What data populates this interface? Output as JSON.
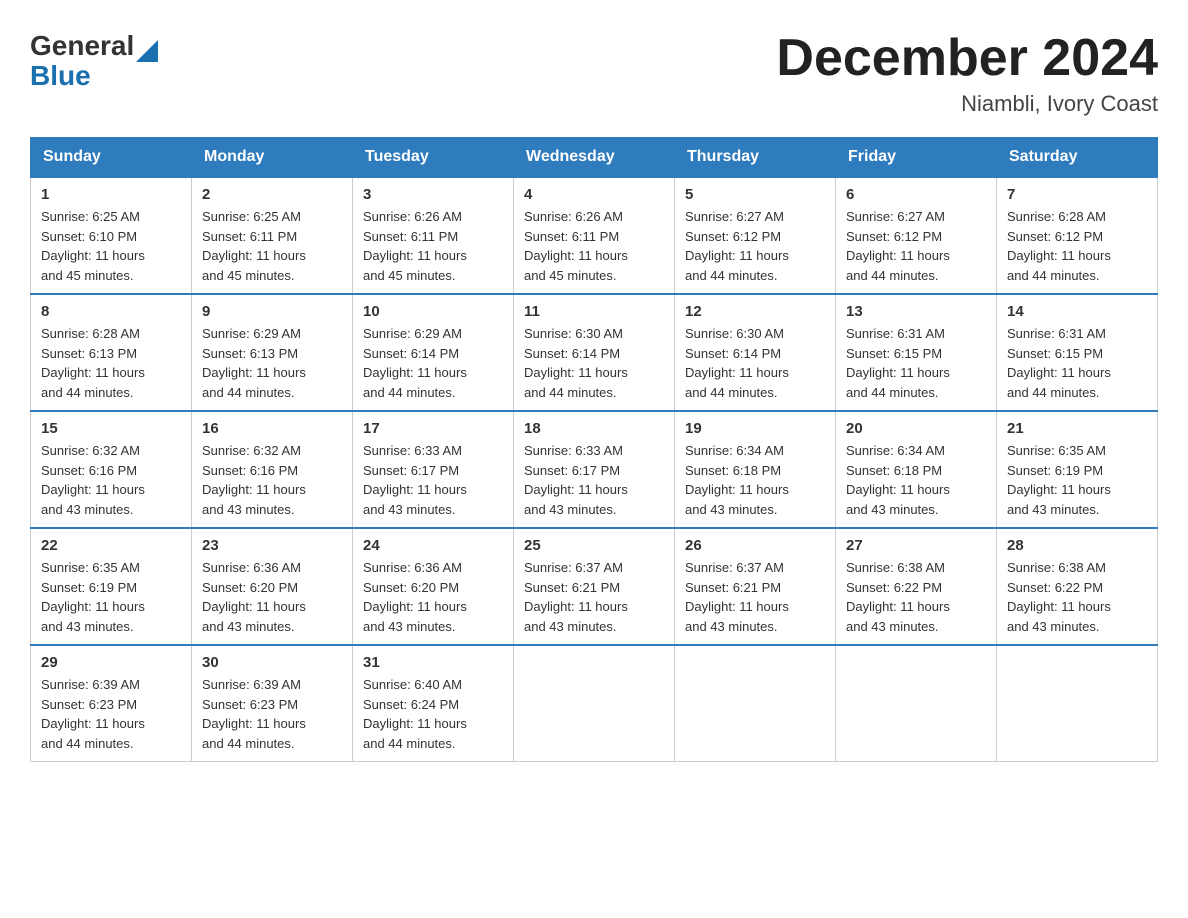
{
  "header": {
    "logo_general": "General",
    "logo_blue": "Blue",
    "month_title": "December 2024",
    "location": "Niambli, Ivory Coast"
  },
  "days_of_week": [
    "Sunday",
    "Monday",
    "Tuesday",
    "Wednesday",
    "Thursday",
    "Friday",
    "Saturday"
  ],
  "weeks": [
    [
      {
        "day": "1",
        "sunrise": "6:25 AM",
        "sunset": "6:10 PM",
        "daylight": "11 hours and 45 minutes."
      },
      {
        "day": "2",
        "sunrise": "6:25 AM",
        "sunset": "6:11 PM",
        "daylight": "11 hours and 45 minutes."
      },
      {
        "day": "3",
        "sunrise": "6:26 AM",
        "sunset": "6:11 PM",
        "daylight": "11 hours and 45 minutes."
      },
      {
        "day": "4",
        "sunrise": "6:26 AM",
        "sunset": "6:11 PM",
        "daylight": "11 hours and 45 minutes."
      },
      {
        "day": "5",
        "sunrise": "6:27 AM",
        "sunset": "6:12 PM",
        "daylight": "11 hours and 44 minutes."
      },
      {
        "day": "6",
        "sunrise": "6:27 AM",
        "sunset": "6:12 PM",
        "daylight": "11 hours and 44 minutes."
      },
      {
        "day": "7",
        "sunrise": "6:28 AM",
        "sunset": "6:12 PM",
        "daylight": "11 hours and 44 minutes."
      }
    ],
    [
      {
        "day": "8",
        "sunrise": "6:28 AM",
        "sunset": "6:13 PM",
        "daylight": "11 hours and 44 minutes."
      },
      {
        "day": "9",
        "sunrise": "6:29 AM",
        "sunset": "6:13 PM",
        "daylight": "11 hours and 44 minutes."
      },
      {
        "day": "10",
        "sunrise": "6:29 AM",
        "sunset": "6:14 PM",
        "daylight": "11 hours and 44 minutes."
      },
      {
        "day": "11",
        "sunrise": "6:30 AM",
        "sunset": "6:14 PM",
        "daylight": "11 hours and 44 minutes."
      },
      {
        "day": "12",
        "sunrise": "6:30 AM",
        "sunset": "6:14 PM",
        "daylight": "11 hours and 44 minutes."
      },
      {
        "day": "13",
        "sunrise": "6:31 AM",
        "sunset": "6:15 PM",
        "daylight": "11 hours and 44 minutes."
      },
      {
        "day": "14",
        "sunrise": "6:31 AM",
        "sunset": "6:15 PM",
        "daylight": "11 hours and 44 minutes."
      }
    ],
    [
      {
        "day": "15",
        "sunrise": "6:32 AM",
        "sunset": "6:16 PM",
        "daylight": "11 hours and 43 minutes."
      },
      {
        "day": "16",
        "sunrise": "6:32 AM",
        "sunset": "6:16 PM",
        "daylight": "11 hours and 43 minutes."
      },
      {
        "day": "17",
        "sunrise": "6:33 AM",
        "sunset": "6:17 PM",
        "daylight": "11 hours and 43 minutes."
      },
      {
        "day": "18",
        "sunrise": "6:33 AM",
        "sunset": "6:17 PM",
        "daylight": "11 hours and 43 minutes."
      },
      {
        "day": "19",
        "sunrise": "6:34 AM",
        "sunset": "6:18 PM",
        "daylight": "11 hours and 43 minutes."
      },
      {
        "day": "20",
        "sunrise": "6:34 AM",
        "sunset": "6:18 PM",
        "daylight": "11 hours and 43 minutes."
      },
      {
        "day": "21",
        "sunrise": "6:35 AM",
        "sunset": "6:19 PM",
        "daylight": "11 hours and 43 minutes."
      }
    ],
    [
      {
        "day": "22",
        "sunrise": "6:35 AM",
        "sunset": "6:19 PM",
        "daylight": "11 hours and 43 minutes."
      },
      {
        "day": "23",
        "sunrise": "6:36 AM",
        "sunset": "6:20 PM",
        "daylight": "11 hours and 43 minutes."
      },
      {
        "day": "24",
        "sunrise": "6:36 AM",
        "sunset": "6:20 PM",
        "daylight": "11 hours and 43 minutes."
      },
      {
        "day": "25",
        "sunrise": "6:37 AM",
        "sunset": "6:21 PM",
        "daylight": "11 hours and 43 minutes."
      },
      {
        "day": "26",
        "sunrise": "6:37 AM",
        "sunset": "6:21 PM",
        "daylight": "11 hours and 43 minutes."
      },
      {
        "day": "27",
        "sunrise": "6:38 AM",
        "sunset": "6:22 PM",
        "daylight": "11 hours and 43 minutes."
      },
      {
        "day": "28",
        "sunrise": "6:38 AM",
        "sunset": "6:22 PM",
        "daylight": "11 hours and 43 minutes."
      }
    ],
    [
      {
        "day": "29",
        "sunrise": "6:39 AM",
        "sunset": "6:23 PM",
        "daylight": "11 hours and 44 minutes."
      },
      {
        "day": "30",
        "sunrise": "6:39 AM",
        "sunset": "6:23 PM",
        "daylight": "11 hours and 44 minutes."
      },
      {
        "day": "31",
        "sunrise": "6:40 AM",
        "sunset": "6:24 PM",
        "daylight": "11 hours and 44 minutes."
      },
      null,
      null,
      null,
      null
    ]
  ],
  "labels": {
    "sunrise": "Sunrise:",
    "sunset": "Sunset:",
    "daylight": "Daylight:"
  }
}
